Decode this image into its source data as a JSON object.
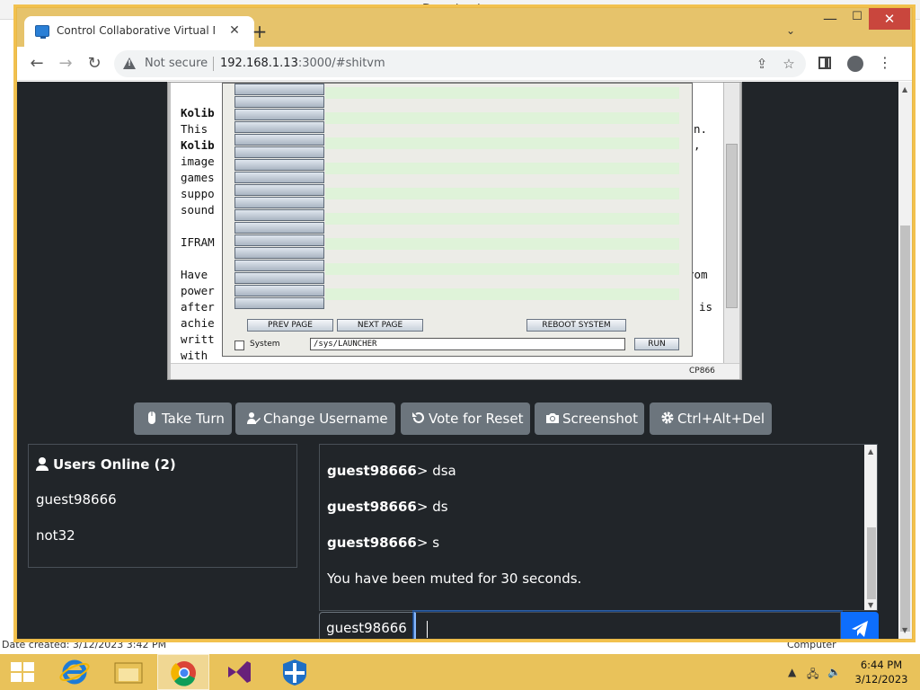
{
  "background_window": {
    "title": "Downloads",
    "status_left": "Date created: 3/12/2023 3:42 PM",
    "status_right": "Computer"
  },
  "browser": {
    "tab_title": "Control Collaborative Virtual Ma",
    "security_label": "Not secure",
    "url_host": "192.168.1.13",
    "url_rest": ":3000/#shitvm"
  },
  "vm": {
    "doc_lines": [
      "Kolib",
      "This ",
      "Kolib",
      "image",
      "games",
      "suppo",
      "sound",
      "IFRAM",
      "Have ",
      "power",
      "after",
      "achie",
      "writt",
      "with "
    ],
    "right_fragments": [
      "n.",
      ",",
      "rom",
      "is"
    ],
    "status_right": "CP866",
    "launcher": {
      "prev_page": "PREV PAGE",
      "next_page": "NEXT PAGE",
      "reboot": "REBOOT SYSTEM",
      "system_label": "System",
      "path_value": "/sys/LAUNCHER",
      "run": "RUN"
    }
  },
  "controls": {
    "take_turn": "Take Turn",
    "change_username": "Change Username",
    "vote_reset": "Vote for Reset",
    "screenshot": "Screenshot",
    "ctrl_alt_del": "Ctrl+Alt+Del"
  },
  "users": {
    "heading": "Users Online (2)",
    "list": [
      "guest98666",
      "not32"
    ]
  },
  "chat": {
    "messages": [
      {
        "user": "guest98666",
        "text": "> dsa"
      },
      {
        "user": "guest98666",
        "text": "> ds"
      },
      {
        "user": "guest98666",
        "text": "> s"
      }
    ],
    "system_message": "You have been muted for 30 seconds.",
    "username": "guest98666",
    "input_value": ""
  },
  "taskbar": {
    "time": "6:44 PM",
    "date": "3/12/2023"
  },
  "colors": {
    "page_bg": "#212529",
    "button_bg": "#6c757d",
    "send_bg": "#0d6efd",
    "window_frame": "#f2c14e"
  }
}
